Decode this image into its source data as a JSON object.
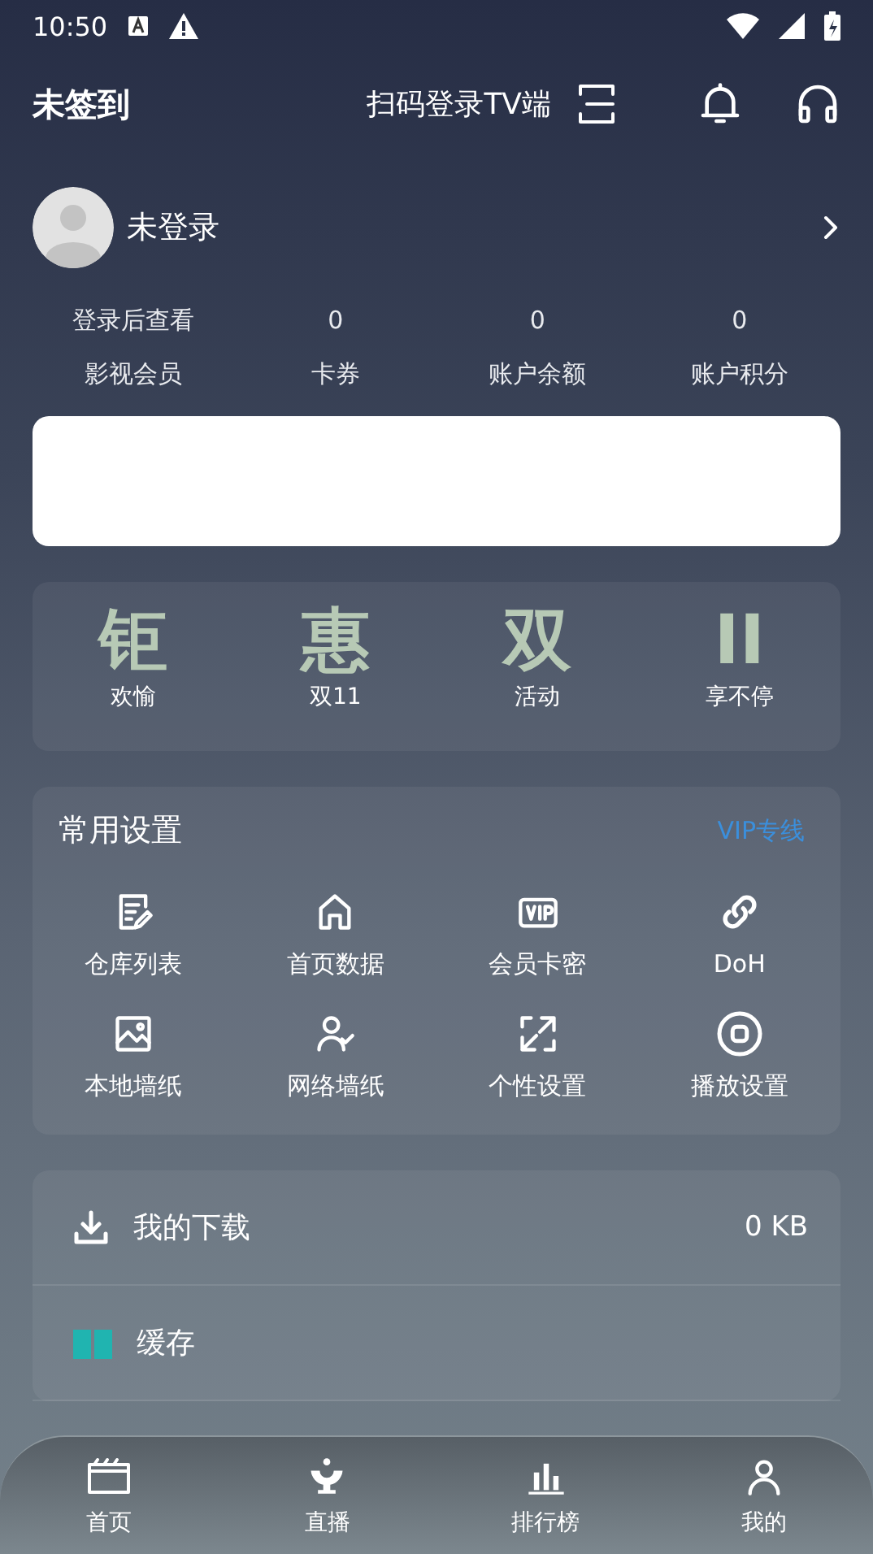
{
  "status_bar": {
    "time": "10:50"
  },
  "header": {
    "title": "未签到",
    "scan_label": "扫码登录TV端"
  },
  "profile": {
    "name": "未登录"
  },
  "stats": [
    {
      "value": "登录后查看",
      "label": "影视会员"
    },
    {
      "value": "0",
      "label": "卡券"
    },
    {
      "value": "0",
      "label": "账户余额"
    },
    {
      "value": "0",
      "label": "账户积分"
    }
  ],
  "promo": [
    {
      "big": "钜",
      "caption": "欢愉"
    },
    {
      "big": "惠",
      "caption": "双11"
    },
    {
      "big": "双",
      "caption": "活动"
    },
    {
      "big": "II",
      "caption": "享不停"
    }
  ],
  "settings": {
    "title": "常用设置",
    "link": "VIP专线",
    "items": [
      {
        "kind": "doc",
        "label": "仓库列表"
      },
      {
        "kind": "home",
        "label": "首页数据"
      },
      {
        "kind": "vip",
        "label": "会员卡密"
      },
      {
        "kind": "link",
        "label": "DoH"
      },
      {
        "kind": "image",
        "label": "本地墙纸"
      },
      {
        "kind": "user",
        "label": "网络墙纸"
      },
      {
        "kind": "expand",
        "label": "个性设置"
      },
      {
        "kind": "play",
        "label": "播放设置"
      }
    ]
  },
  "storage": [
    {
      "kind": "download",
      "label": "我的下载",
      "value": "0 KB"
    },
    {
      "kind": "cache",
      "label": "缓存"
    }
  ],
  "nav": [
    {
      "kind": "film",
      "label": "首页"
    },
    {
      "kind": "live",
      "label": "直播"
    },
    {
      "kind": "chart",
      "label": "排行榜"
    },
    {
      "kind": "user",
      "label": "我的"
    }
  ]
}
